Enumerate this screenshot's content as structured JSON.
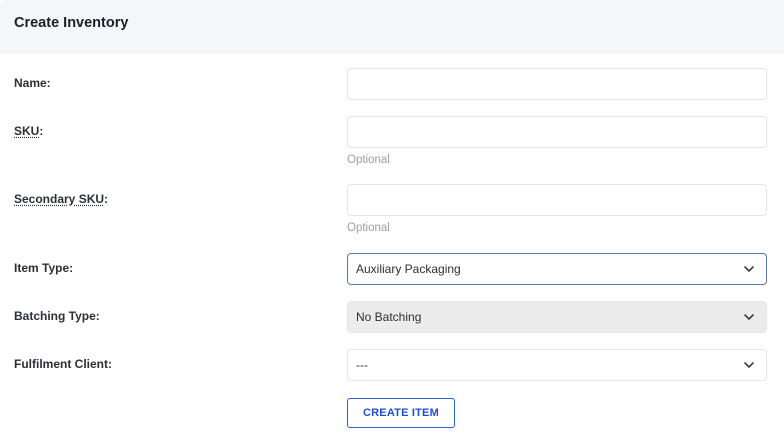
{
  "header": {
    "title": "Create Inventory"
  },
  "form": {
    "name": {
      "label": "Name:",
      "value": ""
    },
    "sku": {
      "label_abbr": "SKU",
      "label_suffix": ":",
      "value": "",
      "hint": "Optional"
    },
    "secondary_sku": {
      "label_prefix": "Secondary ",
      "label_abbr": "SKU",
      "label_suffix": ":",
      "value": "",
      "hint": "Optional"
    },
    "item_type": {
      "label": "Item Type:",
      "selected": "Auxiliary Packaging"
    },
    "batching_type": {
      "label": "Batching Type:",
      "selected": "No Batching"
    },
    "fulfilment_client": {
      "label": "Fulfilment Client:",
      "selected": "---"
    },
    "submit_label": "CREATE ITEM"
  },
  "colors": {
    "accent": "#2d5fd6",
    "header_bg": "#f5f6fa",
    "focus_border": "#5a79a8",
    "disabled_bg": "#ececec"
  }
}
